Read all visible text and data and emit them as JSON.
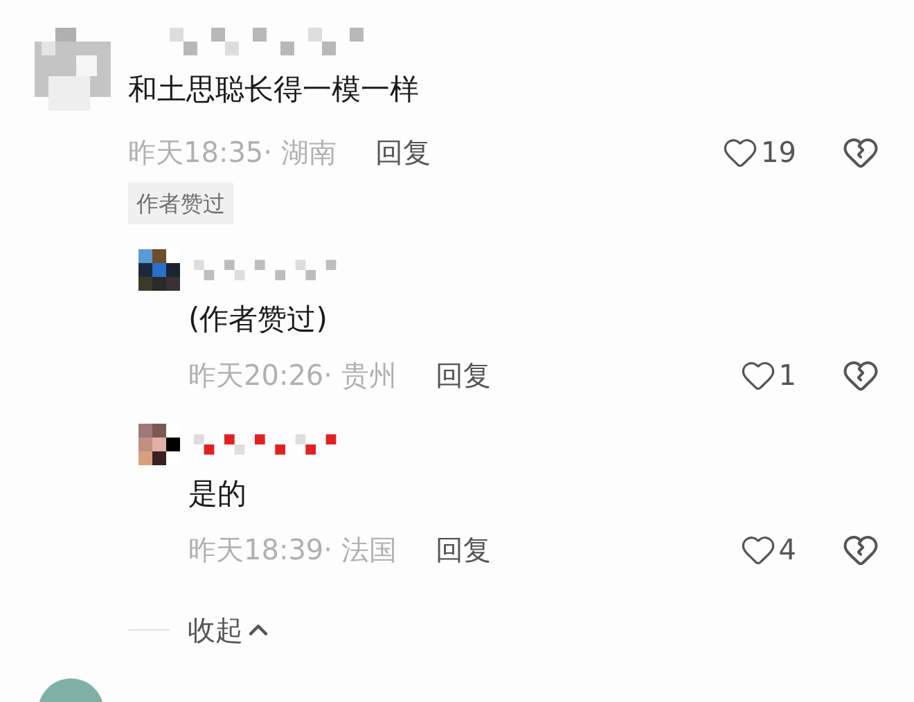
{
  "comment": {
    "text": "和土思聪长得一模一样",
    "meta": "昨天18:35· 湖南",
    "reply": "回复",
    "likes": "19",
    "badge": "作者赞过",
    "replies": [
      {
        "text": "(作者赞过)",
        "meta": "昨天20:26· 贵州",
        "reply": "回复",
        "likes": "1"
      },
      {
        "text": "是的",
        "meta": "昨天18:39· 法国",
        "reply": "回复",
        "likes": "4"
      }
    ]
  },
  "collapse": {
    "label": "收起"
  }
}
